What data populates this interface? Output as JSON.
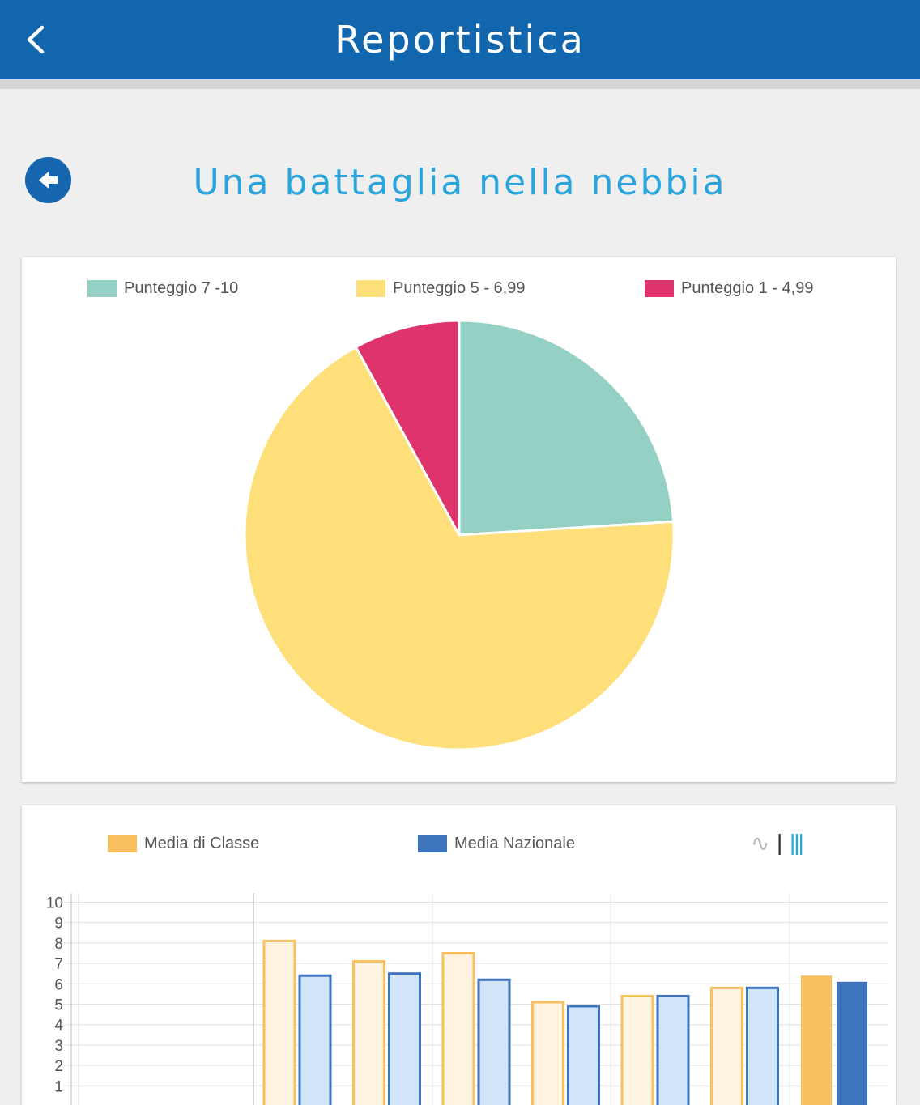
{
  "header": {
    "title": "Reportistica",
    "back_icon": "chevron-left-icon"
  },
  "page": {
    "title": "Una battaglia nella nebbia",
    "back_icon": "arrow-left-circle-icon"
  },
  "colors": {
    "header_bg": "#1166ae",
    "title_color": "#2aa4dd",
    "teal": "#94d0c4",
    "yellow": "#fedf7a",
    "pink": "#de336b",
    "class_orange": "#fbc05e",
    "national_blue": "#3d74bd"
  },
  "pie_legend": [
    {
      "label": "Punteggio 7 -10",
      "color": "#94d0c4"
    },
    {
      "label": "Punteggio 5 - 6,99",
      "color": "#fedf7a"
    },
    {
      "label": "Punteggio 1 - 4,99",
      "color": "#de336b"
    }
  ],
  "bar_legend": [
    {
      "label": "Media di Classe",
      "color": "#fbc05e"
    },
    {
      "label": "Media Nazionale",
      "color": "#3d74bd"
    }
  ],
  "chart_toggles": {
    "line_glyph": "∿",
    "separator": "|",
    "bar_glyph": "|||",
    "line_icon": "line-chart-icon",
    "bar_icon": "bar-chart-icon"
  },
  "chart_data": [
    {
      "type": "pie",
      "labels": [
        "Punteggio 7 -10",
        "Punteggio 5 - 6,99",
        "Punteggio 1 - 4,99"
      ],
      "values": [
        24,
        68,
        8
      ],
      "colors": [
        "#94d0c4",
        "#fedf7a",
        "#de336b"
      ]
    },
    {
      "type": "bar",
      "ylim": [
        0,
        10
      ],
      "yticks": [
        1,
        2,
        3,
        4,
        5,
        6,
        7,
        8,
        9,
        10
      ],
      "grid": true,
      "series": [
        {
          "name": "Media di Classe",
          "values": [
            8.1,
            7.1,
            7.5,
            5.1,
            5.4,
            5.8,
            6.4
          ]
        },
        {
          "name": "Media Nazionale",
          "values": [
            6.4,
            6.5,
            6.2,
            4.9,
            5.4,
            5.8,
            6.1
          ]
        }
      ]
    }
  ]
}
